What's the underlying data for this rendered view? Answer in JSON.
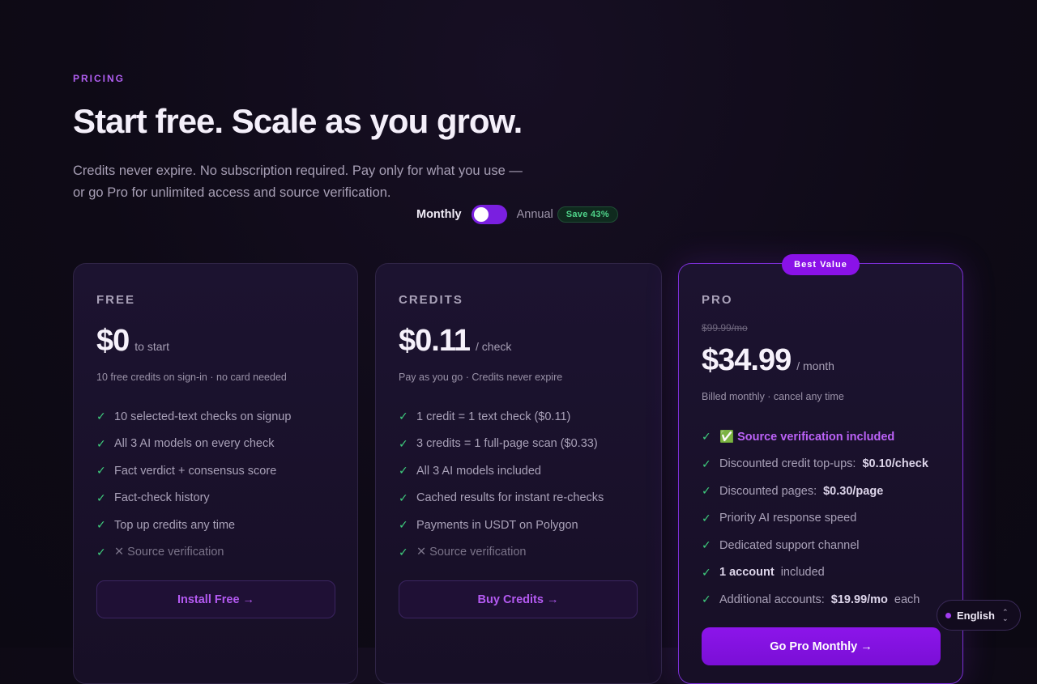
{
  "header": {
    "eyebrow": "PRICING",
    "title": "Start free. Scale as you grow.",
    "subtitle": "Credits never expire. No subscription required. Pay only for what you use — or go Pro for unlimited access and source verification."
  },
  "billing_toggle": {
    "monthly_label": "Monthly",
    "annual_label": "Annual",
    "save_badge": "Save 43%",
    "selected": "Monthly"
  },
  "plans": {
    "free": {
      "tier": "FREE",
      "price": "$0",
      "unit": "to start",
      "note": "10 free credits on sign-in · no card needed",
      "features": [
        "10 selected-text checks on signup",
        "All 3 AI models on every check",
        "Fact verdict + consensus score",
        "Fact-check history",
        "Top up credits any time",
        "✕ Source verification"
      ],
      "cta": "Install Free →"
    },
    "credits": {
      "tier": "CREDITS",
      "price": "$0.11",
      "unit": "/ check",
      "note": "Pay as you go · Credits never expire",
      "features": [
        "1 credit = 1 text check ($0.11)",
        "3 credits = 1 full-page scan ($0.33)",
        "All 3 AI models included",
        "Cached results for instant re-checks",
        "Payments in USDT on Polygon",
        "✕ Source verification"
      ],
      "cta": "Buy Credits →"
    },
    "pro": {
      "badge": "Best Value",
      "tier": "PRO",
      "original_price": "$99.99/mo",
      "price": "$34.99",
      "unit": "/ month",
      "note": "Billed monthly · cancel any time",
      "features": [
        {
          "label": "✅ Source verification included"
        },
        {
          "label": "Discounted credit top-ups:",
          "strong": "$0.10/check"
        },
        {
          "label": "Discounted pages:",
          "strong": "$0.30/page"
        },
        {
          "label": "Priority AI response speed"
        },
        {
          "label": "Dedicated support channel"
        },
        {
          "label": "1 account",
          "after": "included"
        },
        {
          "label": "Additional accounts:",
          "strong": "$19.99/mo",
          "after": "each"
        }
      ],
      "cta": "Go Pro Monthly →"
    }
  },
  "language_selector": {
    "label": "English"
  },
  "colors": {
    "accent": "#8a12e8",
    "check": "#3fcf7e",
    "badge_green": "#4fd48a"
  }
}
